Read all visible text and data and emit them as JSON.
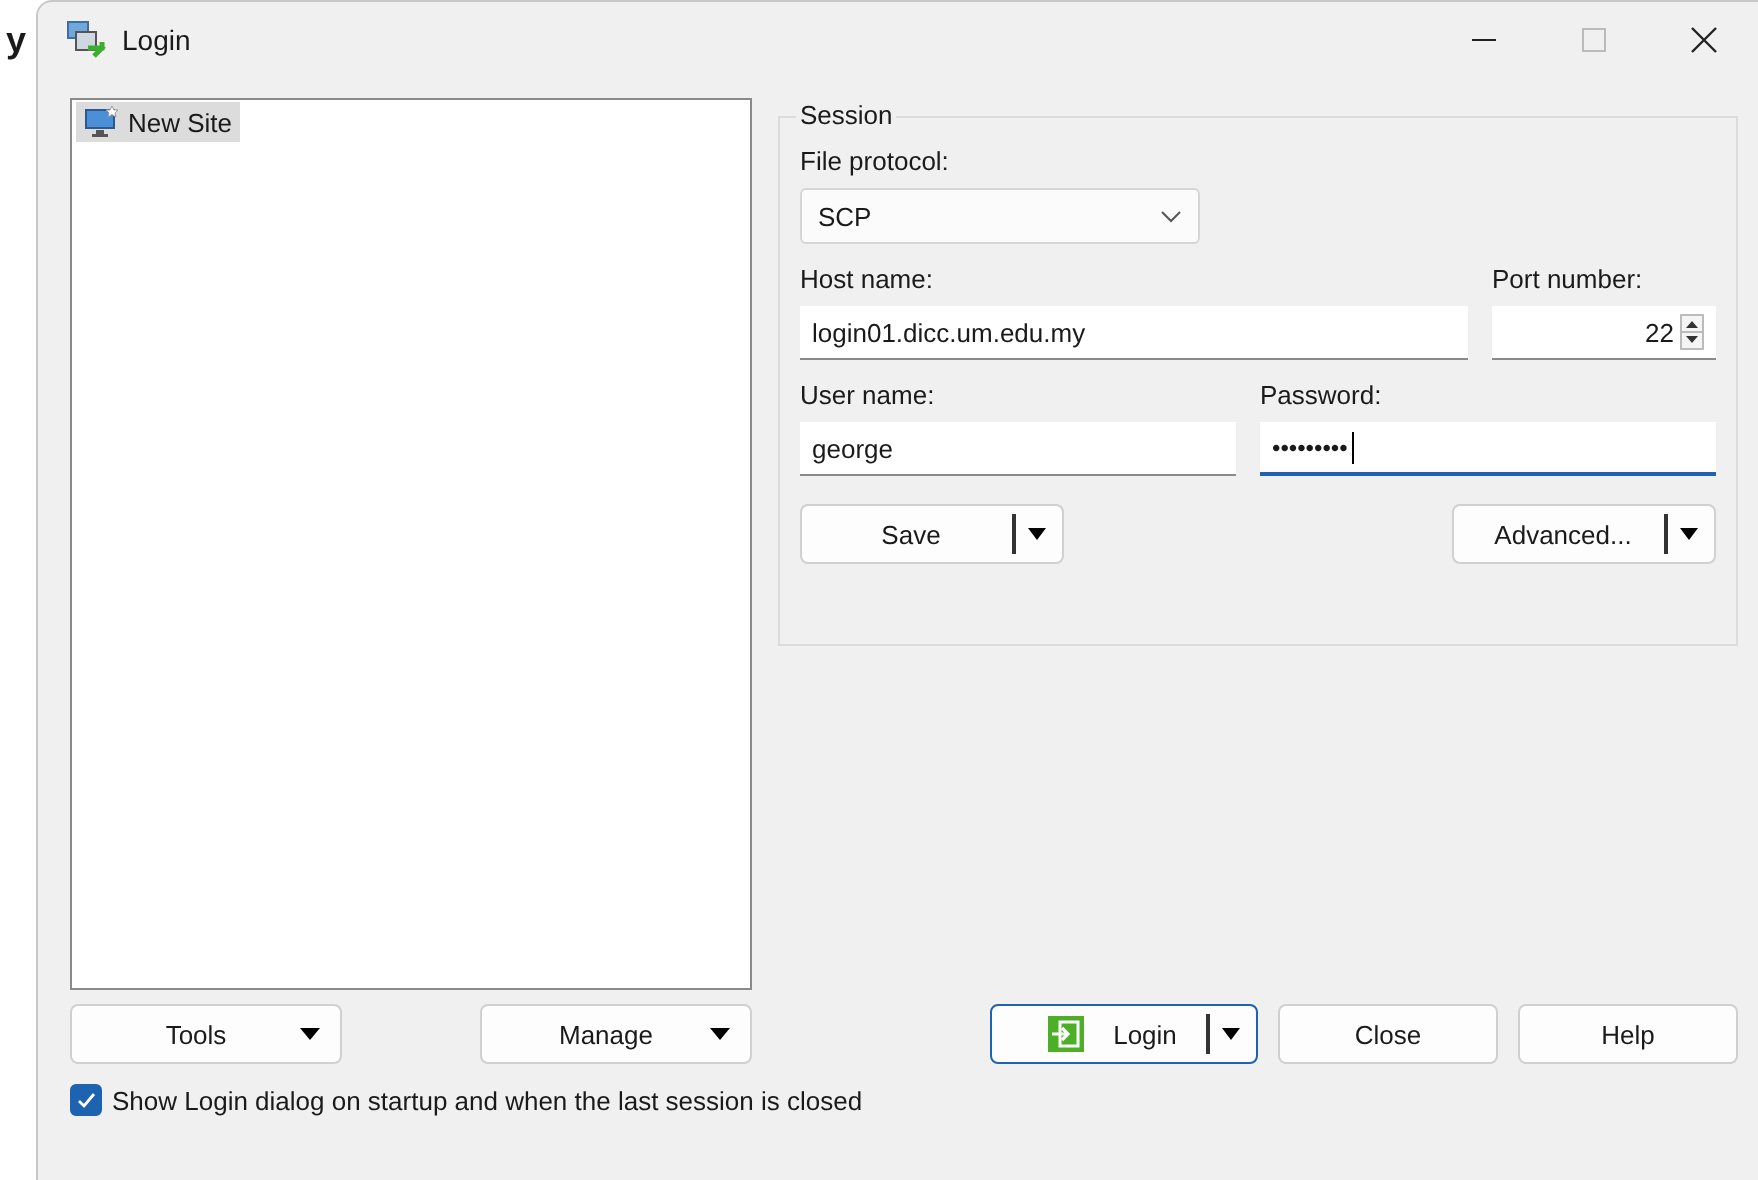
{
  "outside_text": "y",
  "window": {
    "title": "Login",
    "maximize_disabled": true
  },
  "sites": [
    {
      "label": "New Site",
      "selected": true
    }
  ],
  "left_buttons": [
    {
      "label": "Tools"
    },
    {
      "label": "Manage"
    }
  ],
  "session": {
    "title": "Session",
    "protocol_label": "File protocol:",
    "protocol": "SCP",
    "host_label": "Host name:",
    "host": "login01.dicc.um.edu.my",
    "port_label": "Port number:",
    "port": "22",
    "user_label": "User name:",
    "user": "george",
    "password_label": "Password:",
    "password": "•••••••••",
    "password_focused": true,
    "save_button": "Save",
    "advanced_button": "Advanced..."
  },
  "buttons": [
    {
      "label": "Login",
      "kind": "split",
      "default": true
    },
    {
      "label": "Close",
      "kind": "plain",
      "default": false
    },
    {
      "label": "Help",
      "kind": "plain",
      "default": false
    }
  ],
  "show_on_startup": {
    "label": "Show Login dialog on startup and when the last session is closed",
    "checked": true
  }
}
